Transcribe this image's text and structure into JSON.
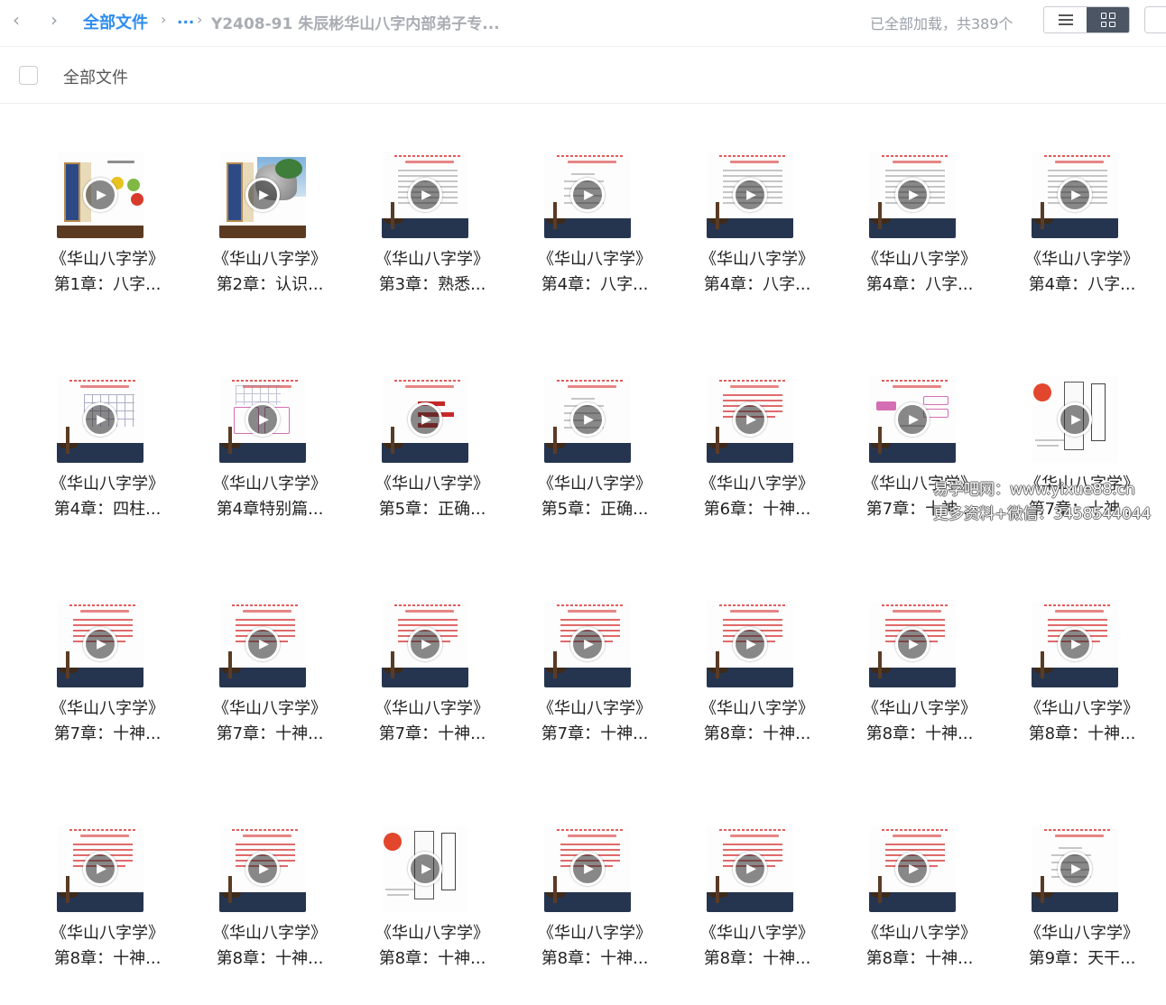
{
  "toolbar": {
    "back_icon": "chevron-left-icon",
    "forward_icon": "chevron-right-icon",
    "breadcrumb_root": "全部文件",
    "breadcrumb_ellipsis": "...",
    "breadcrumb_current": "Y2408-91 朱辰彬华山八字内部弟子专...",
    "load_status": "已全部加载，共389个",
    "view_modes": [
      "list-view",
      "grid-view"
    ],
    "active_view": "grid-view"
  },
  "subheader": {
    "title": "全部文件"
  },
  "files": [
    {
      "line1": "《华山八字学》",
      "line2": "第1章：八字...",
      "thumb": "scroll-fruit"
    },
    {
      "line1": "《华山八字学》",
      "line2": "第2章：认识...",
      "thumb": "scroll-rock"
    },
    {
      "line1": "《华山八字学》",
      "line2": "第3章：熟悉...",
      "thumb": "text"
    },
    {
      "line1": "《华山八字学》",
      "line2": "第4章：八字...",
      "thumb": "chart"
    },
    {
      "line1": "《华山八字学》",
      "line2": "第4章：八字...",
      "thumb": "text"
    },
    {
      "line1": "《华山八字学》",
      "line2": "第4章：八字...",
      "thumb": "text"
    },
    {
      "line1": "《华山八字学》",
      "line2": "第4章：八字...",
      "thumb": "text"
    },
    {
      "line1": "《华山八字学》",
      "line2": "第4章：四柱...",
      "thumb": "grid"
    },
    {
      "line1": "《华山八字学》",
      "line2": "第4章特别篇...",
      "thumb": "diagram"
    },
    {
      "line1": "《华山八字学》",
      "line2": "第5章：正确...",
      "thumb": "bars"
    },
    {
      "line1": "《华山八字学》",
      "line2": "第5章：正确...",
      "thumb": "chart"
    },
    {
      "line1": "《华山八字学》",
      "line2": "第6章：十神...",
      "thumb": "redtext"
    },
    {
      "line1": "《华山八字学》",
      "line2": "第7章：十神...",
      "thumb": "boxes"
    },
    {
      "line1": "《华山八字学》",
      "line2": "第7章：十神...",
      "thumb": "ink"
    },
    {
      "line1": "《华山八字学》",
      "line2": "第7章：十神...",
      "thumb": "redtext"
    },
    {
      "line1": "《华山八字学》",
      "line2": "第7章：十神...",
      "thumb": "redtext"
    },
    {
      "line1": "《华山八字学》",
      "line2": "第7章：十神...",
      "thumb": "redtext"
    },
    {
      "line1": "《华山八字学》",
      "line2": "第7章：十神...",
      "thumb": "redtext"
    },
    {
      "line1": "《华山八字学》",
      "line2": "第8章：十神...",
      "thumb": "redtext"
    },
    {
      "line1": "《华山八字学》",
      "line2": "第8章：十神...",
      "thumb": "redtext"
    },
    {
      "line1": "《华山八字学》",
      "line2": "第8章：十神...",
      "thumb": "redtext"
    },
    {
      "line1": "《华山八字学》",
      "line2": "第8章：十神...",
      "thumb": "redtext"
    },
    {
      "line1": "《华山八字学》",
      "line2": "第8章：十神...",
      "thumb": "redtext"
    },
    {
      "line1": "《华山八字学》",
      "line2": "第8章：十神...",
      "thumb": "ink"
    },
    {
      "line1": "《华山八字学》",
      "line2": "第8章：十神...",
      "thumb": "redtext"
    },
    {
      "line1": "《华山八字学》",
      "line2": "第8章：十神...",
      "thumb": "redtext"
    },
    {
      "line1": "《华山八字学》",
      "line2": "第8章：十神...",
      "thumb": "redtext"
    },
    {
      "line1": "《华山八字学》",
      "line2": "第9章：天干...",
      "thumb": "chart"
    }
  ],
  "watermark": {
    "line1": "易学吧网：www.yixue88.cn",
    "line2": "更多资料+微信：3458544044"
  },
  "icons": {
    "play": "play-icon",
    "select_all": "checkbox-icon"
  },
  "colors": {
    "accent": "#2d8cf0",
    "muted": "#a9adb3",
    "thumb_band": "#26354f",
    "slide_red": "#c62828"
  }
}
